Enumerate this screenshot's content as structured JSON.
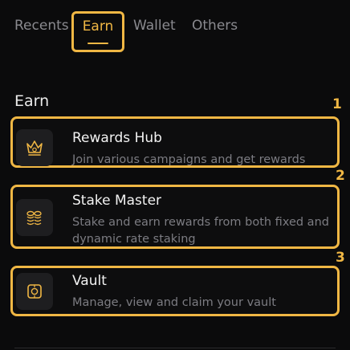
{
  "tabs": {
    "recents": "Recents",
    "earn": "Earn",
    "wallet": "Wallet",
    "others": "Others"
  },
  "section": {
    "title": "Earn"
  },
  "markers": [
    "1",
    "2",
    "3"
  ],
  "items": [
    {
      "title": "Rewards Hub",
      "description": "Join various campaigns and get rewards",
      "icon": "crown-icon"
    },
    {
      "title": "Stake Master",
      "description": "Stake and earn rewards from both fixed and dynamic rate staking",
      "icon": "coins-icon"
    },
    {
      "title": "Vault",
      "description": "Manage, view and claim your vault",
      "icon": "vault-icon"
    }
  ],
  "colors": {
    "accent": "#f0b744",
    "background": "#0b0b0c",
    "icon_bg": "#1e1e20",
    "muted_text": "#7c7c82"
  }
}
